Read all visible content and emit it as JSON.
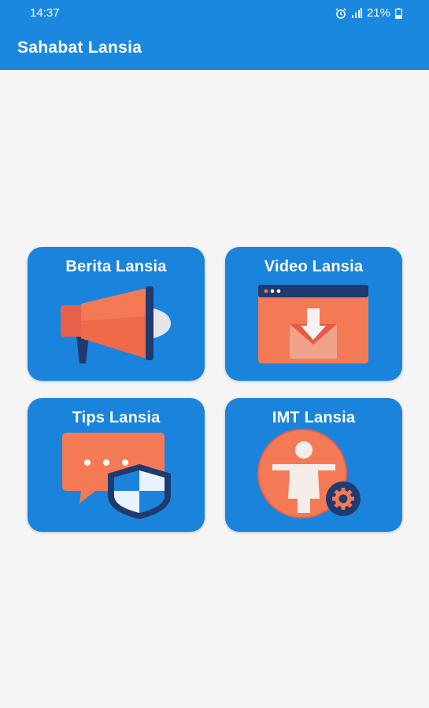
{
  "status_bar": {
    "time": "14:37",
    "battery": "21%",
    "icons": [
      "alarm-icon",
      "signal-icon",
      "battery-icon"
    ]
  },
  "app_bar": {
    "title": "Sahabat Lansia"
  },
  "menu": {
    "items": [
      {
        "label": "Berita Lansia",
        "icon": "megaphone-icon"
      },
      {
        "label": "Video Lansia",
        "icon": "video-download-icon"
      },
      {
        "label": "Tips Lansia",
        "icon": "chat-shield-icon"
      },
      {
        "label": "IMT Lansia",
        "icon": "body-settings-icon"
      }
    ]
  },
  "colors": {
    "primary": "#1b88e0",
    "card": "#1a84dc",
    "accent_orange": "#f26e4e",
    "background": "#f5f5f5"
  }
}
